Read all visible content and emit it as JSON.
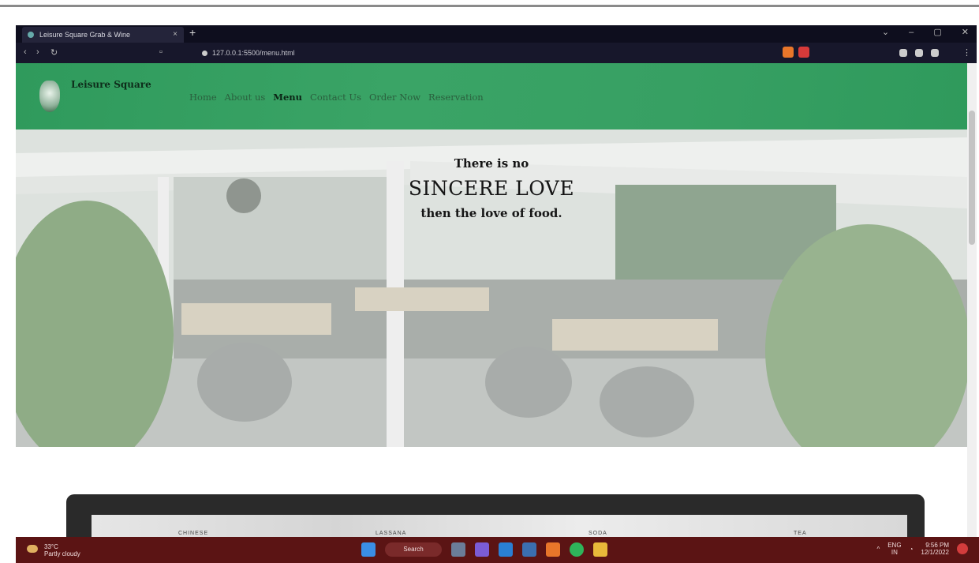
{
  "browser": {
    "tab_title": "Leisure Square Grab & Wine",
    "url": "127.0.0.1:5500/menu.html",
    "tab_close": "×",
    "new_tab": "+",
    "window_controls": [
      "⌄",
      "–",
      "▢",
      "✕"
    ]
  },
  "site": {
    "brand": "Leisure Square",
    "nav": [
      "Home",
      "About us",
      "Menu",
      "Contact Us",
      "Order Now",
      "Reservation"
    ],
    "active_nav": "Menu",
    "hero": {
      "line1": "There is no",
      "line2": "SINCERE LOVE",
      "line3": "then the love of food."
    },
    "menu_board": {
      "columns": [
        "CHINESE",
        "LASSANA",
        "SODA",
        "TEA"
      ]
    }
  },
  "taskbar": {
    "weather_temp": "33°C",
    "weather_desc": "Partly cloudy",
    "search_label": "Search",
    "lang": "ENG",
    "lang_sub": "IN",
    "time": "9:56 PM",
    "date": "12/1/2022"
  },
  "colors": {
    "nav_green": "#37a063",
    "taskbar": "#5b1414",
    "browser_dark": "#0e0e1e"
  }
}
